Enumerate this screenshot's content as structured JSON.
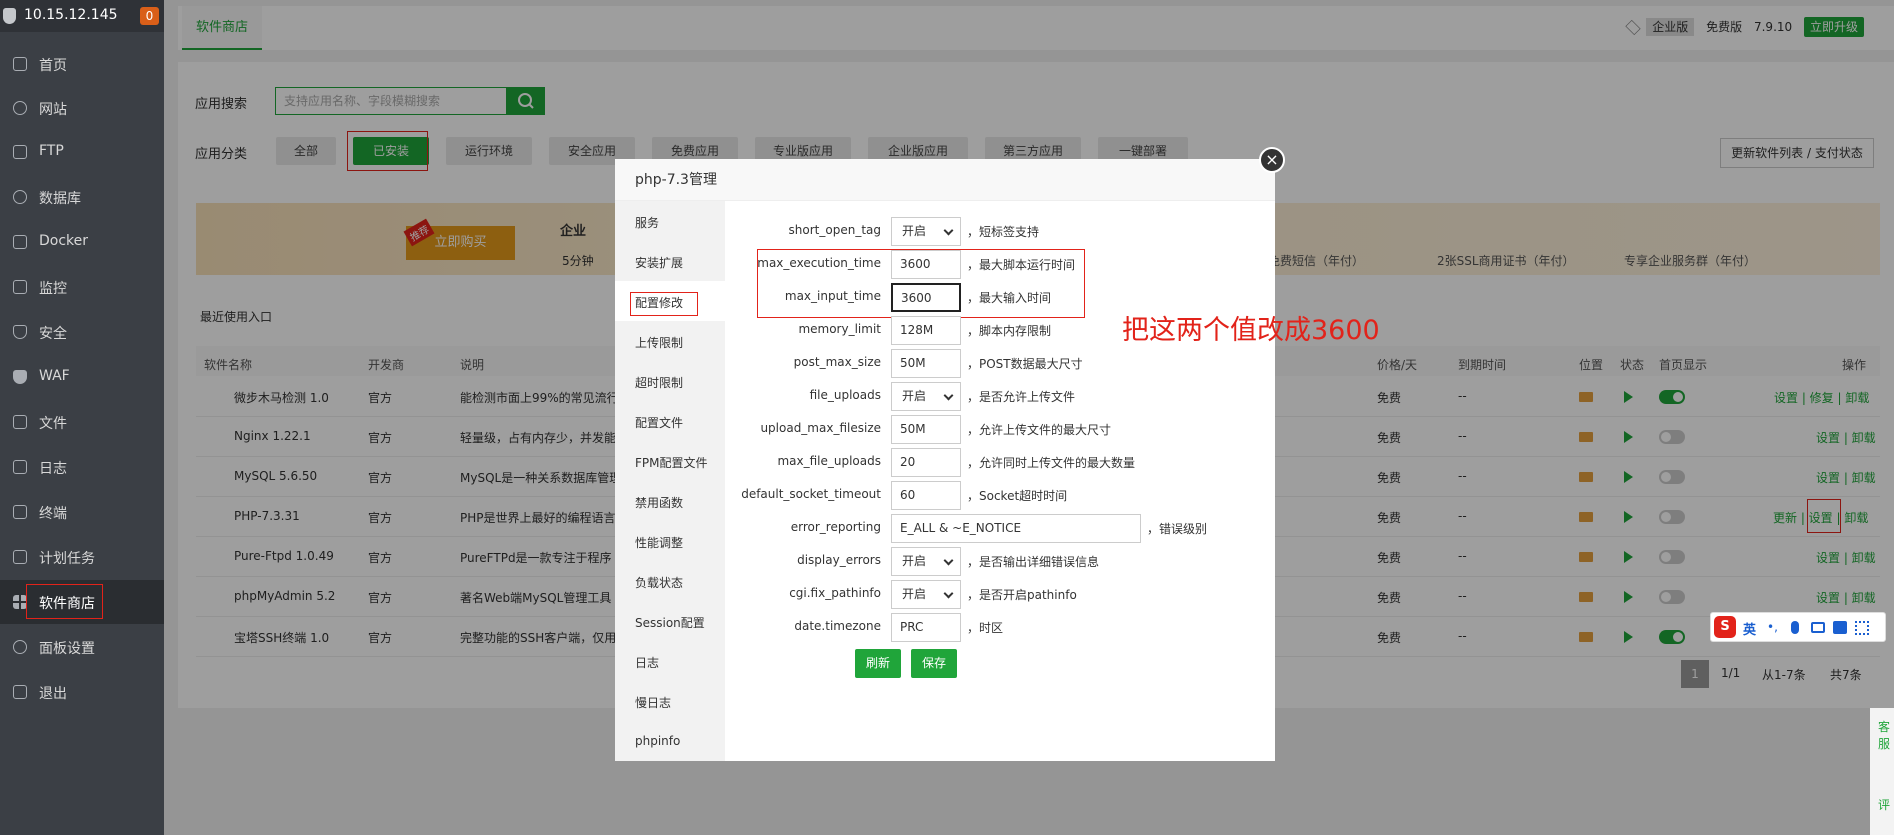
{
  "sidebar": {
    "ip": "10.15.12.145",
    "badge": "0",
    "items": [
      {
        "label": "首页",
        "icon": "home-icon"
      },
      {
        "label": "网站",
        "icon": "globe-icon"
      },
      {
        "label": "FTP",
        "icon": "ftp-icon"
      },
      {
        "label": "数据库",
        "icon": "database-icon"
      },
      {
        "label": "Docker",
        "icon": "docker-icon"
      },
      {
        "label": "监控",
        "icon": "monitor-icon"
      },
      {
        "label": "安全",
        "icon": "shield-icon"
      },
      {
        "label": "WAF",
        "icon": "waf-icon"
      },
      {
        "label": "文件",
        "icon": "folder-icon"
      },
      {
        "label": "日志",
        "icon": "log-icon"
      },
      {
        "label": "终端",
        "icon": "terminal-icon"
      },
      {
        "label": "计划任务",
        "icon": "calendar-icon"
      },
      {
        "label": "软件商店",
        "icon": "store-icon"
      },
      {
        "label": "面板设置",
        "icon": "gear-icon"
      },
      {
        "label": "退出",
        "icon": "logout-icon"
      }
    ]
  },
  "topbar": {
    "tab": "软件商店",
    "edition": "企业版",
    "free": "免费版",
    "version": "7.9.10",
    "upgrade": "立即升级"
  },
  "search": {
    "label": "应用搜索",
    "placeholder": "支持应用名称、字段模糊搜索"
  },
  "categories": {
    "label": "应用分类",
    "items": [
      "全部",
      "已安装",
      "运行环境",
      "安全应用",
      "免费应用",
      "专业版应用",
      "企业版应用",
      "第三方应用",
      "一键部署"
    ],
    "update_btn": "更新软件列表 / 支付状态"
  },
  "banner": {
    "tag": "推荐",
    "buy": "立即购买",
    "title": "企业",
    "sub": "5分钟",
    "f1": "免费短信（年付）",
    "f2": "2张SSL商用证书（年付）",
    "f3": "专享企业服务群（年付）"
  },
  "recent": "最近使用入口",
  "table": {
    "headers": [
      "软件名称",
      "开发商",
      "说明",
      "价格/天",
      "到期时间",
      "位置",
      "状态",
      "首页显示",
      "操作"
    ],
    "rows": [
      {
        "name": "微步木马检测 1.0",
        "dev": "官方",
        "desc": "能检测市面上99%的常见流行",
        "price": "免费",
        "expire": "--",
        "ops": "设置 | 修复 | 卸载"
      },
      {
        "name": "Nginx 1.22.1",
        "dev": "官方",
        "desc": "轻量级，占有内存少，并发能",
        "price": "免费",
        "expire": "--",
        "ops": "设置 | 卸载"
      },
      {
        "name": "MySQL 5.6.50",
        "dev": "官方",
        "desc": "MySQL是一种关系数据库管理",
        "price": "免费",
        "expire": "--",
        "ops": "设置 | 卸载"
      },
      {
        "name": "PHP-7.3.31",
        "dev": "官方",
        "desc": "PHP是世界上最好的编程语言",
        "price": "免费",
        "expire": "--",
        "ops": "更新 | 设置 | 卸载"
      },
      {
        "name": "Pure-Ftpd 1.0.49",
        "dev": "官方",
        "desc": "PureFTPd是一款专注于程序",
        "price": "免费",
        "expire": "--",
        "ops": "设置 | 卸载"
      },
      {
        "name": "phpMyAdmin 5.2",
        "dev": "官方",
        "desc": "著名Web端MySQL管理工具",
        "price": "免费",
        "expire": "--",
        "ops": "设置 | 卸载"
      },
      {
        "name": "宝塔SSH终端 1.0",
        "dev": "官方",
        "desc": "完整功能的SSH客户端，仅用",
        "price": "免费",
        "expire": "--",
        "ops": ""
      }
    ]
  },
  "pager": {
    "page": "1",
    "ratio": "1/1",
    "range": "从1-7条",
    "total": "共7条"
  },
  "modal": {
    "title": "php-7.3管理",
    "close": "×",
    "side": [
      "服务",
      "安装扩展",
      "配置修改",
      "上传限制",
      "超时限制",
      "配置文件",
      "FPM配置文件",
      "禁用函数",
      "性能调整",
      "负载状态",
      "Session配置",
      "日志",
      "慢日志",
      "phpinfo"
    ],
    "fields": [
      {
        "label": "short_open_tag",
        "value": "开启",
        "desc": "，短标签支持"
      },
      {
        "label": "max_execution_time",
        "value": "3600",
        "desc": "，最大脚本运行时间"
      },
      {
        "label": "max_input_time",
        "value": "3600",
        "desc": "，最大输入时间"
      },
      {
        "label": "memory_limit",
        "value": "128M",
        "desc": "，脚本内存限制"
      },
      {
        "label": "post_max_size",
        "value": "50M",
        "desc": "，POST数据最大尺寸"
      },
      {
        "label": "file_uploads",
        "value": "开启",
        "desc": "，是否允许上传文件"
      },
      {
        "label": "upload_max_filesize",
        "value": "50M",
        "desc": "，允许上传文件的最大尺寸"
      },
      {
        "label": "max_file_uploads",
        "value": "20",
        "desc": "，允许同时上传文件的最大数量"
      },
      {
        "label": "default_socket_timeout",
        "value": "60",
        "desc": "，Socket超时时间"
      },
      {
        "label": "error_reporting",
        "value": "E_ALL & ~E_NOTICE",
        "desc": "，错误级别"
      },
      {
        "label": "display_errors",
        "value": "开启",
        "desc": "，是否输出详细错误信息"
      },
      {
        "label": "cgi.fix_pathinfo",
        "value": "开启",
        "desc": "，是否开启pathinfo"
      },
      {
        "label": "date.timezone",
        "value": "PRC",
        "desc": "，时区"
      }
    ],
    "refresh": "刷新",
    "save": "保存"
  },
  "annotation": "把这两个值改成3600",
  "ime": {
    "logo": "S",
    "lang": "英"
  },
  "float": {
    "t1": "客",
    "t2": "服",
    "t3": "评"
  },
  "colors": {
    "brand": "#20a53a",
    "sidebar": "#3b3f45",
    "annotation": "#e2231a"
  }
}
